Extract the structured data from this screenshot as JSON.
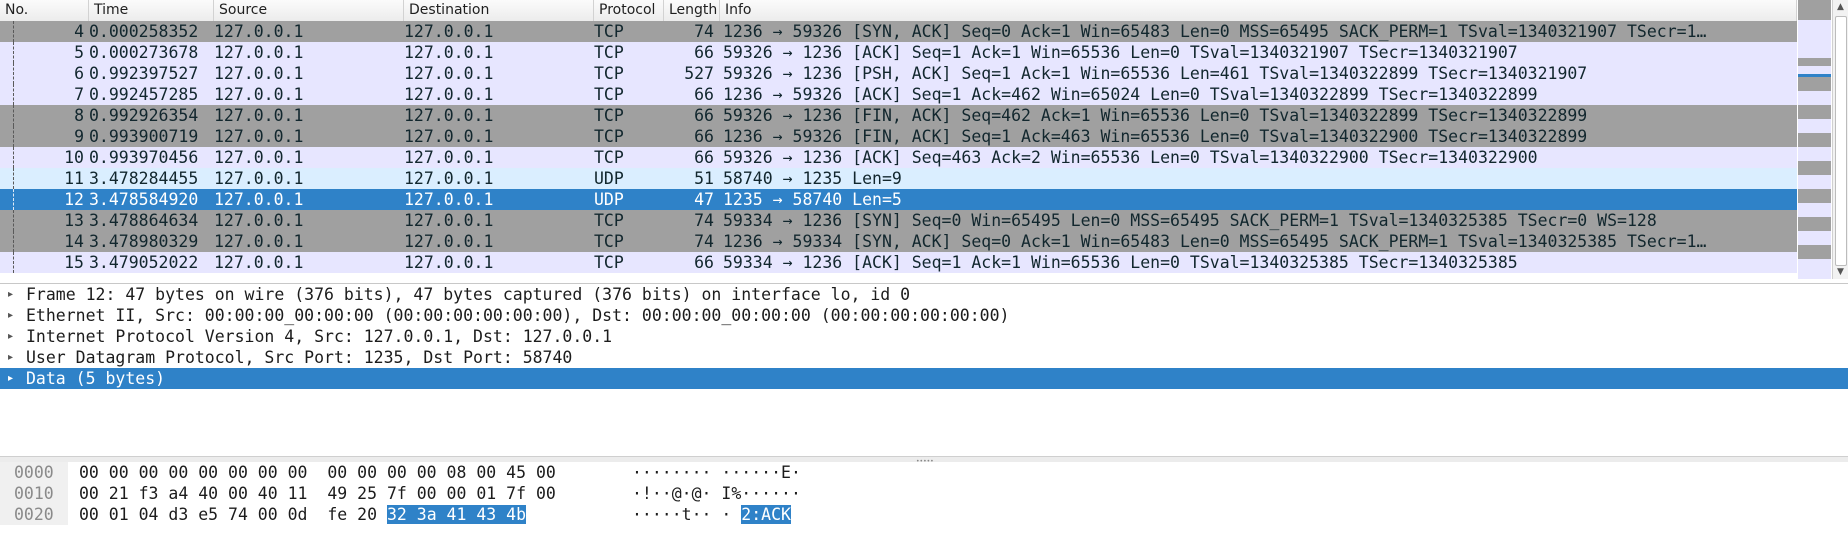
{
  "columns": [
    "No.",
    "Time",
    "Source",
    "Destination",
    "Protocol",
    "Length",
    "Info"
  ],
  "packets": [
    {
      "no": "4",
      "time": "0.000258352",
      "src": "127.0.0.1",
      "dst": "127.0.0.1",
      "proto": "TCP",
      "len": "74",
      "info": "1236 → 59326 [SYN, ACK] Seq=0 Ack=1 Win=65483 Len=0 MSS=65495 SACK_PERM=1 TSval=1340321907 TSecr=1…",
      "style": "tcp-flag"
    },
    {
      "no": "5",
      "time": "0.000273678",
      "src": "127.0.0.1",
      "dst": "127.0.0.1",
      "proto": "TCP",
      "len": "66",
      "info": "59326 → 1236 [ACK] Seq=1 Ack=1 Win=65536 Len=0 TSval=1340321907 TSecr=1340321907",
      "style": "tcp-normal"
    },
    {
      "no": "6",
      "time": "0.992397527",
      "src": "127.0.0.1",
      "dst": "127.0.0.1",
      "proto": "TCP",
      "len": "527",
      "info": "59326 → 1236 [PSH, ACK] Seq=1 Ack=1 Win=65536 Len=461 TSval=1340322899 TSecr=1340321907",
      "style": "tcp-normal"
    },
    {
      "no": "7",
      "time": "0.992457285",
      "src": "127.0.0.1",
      "dst": "127.0.0.1",
      "proto": "TCP",
      "len": "66",
      "info": "1236 → 59326 [ACK] Seq=1 Ack=462 Win=65024 Len=0 TSval=1340322899 TSecr=1340322899",
      "style": "tcp-normal"
    },
    {
      "no": "8",
      "time": "0.992926354",
      "src": "127.0.0.1",
      "dst": "127.0.0.1",
      "proto": "TCP",
      "len": "66",
      "info": "59326 → 1236 [FIN, ACK] Seq=462 Ack=1 Win=65536 Len=0 TSval=1340322899 TSecr=1340322899",
      "style": "tcp-flag"
    },
    {
      "no": "9",
      "time": "0.993900719",
      "src": "127.0.0.1",
      "dst": "127.0.0.1",
      "proto": "TCP",
      "len": "66",
      "info": "1236 → 59326 [FIN, ACK] Seq=1 Ack=463 Win=65536 Len=0 TSval=1340322900 TSecr=1340322899",
      "style": "tcp-flag"
    },
    {
      "no": "10",
      "time": "0.993970456",
      "src": "127.0.0.1",
      "dst": "127.0.0.1",
      "proto": "TCP",
      "len": "66",
      "info": "59326 → 1236 [ACK] Seq=463 Ack=2 Win=65536 Len=0 TSval=1340322900 TSecr=1340322900",
      "style": "tcp-normal"
    },
    {
      "no": "11",
      "time": "3.478284455",
      "src": "127.0.0.1",
      "dst": "127.0.0.1",
      "proto": "UDP",
      "len": "51",
      "info": "58740 → 1235 Len=9",
      "style": "udp"
    },
    {
      "no": "12",
      "time": "3.478584920",
      "src": "127.0.0.1",
      "dst": "127.0.0.1",
      "proto": "UDP",
      "len": "47",
      "info": "1235 → 58740 Len=5",
      "style": "selected"
    },
    {
      "no": "13",
      "time": "3.478864634",
      "src": "127.0.0.1",
      "dst": "127.0.0.1",
      "proto": "TCP",
      "len": "74",
      "info": "59334 → 1236 [SYN] Seq=0 Win=65495 Len=0 MSS=65495 SACK_PERM=1 TSval=1340325385 TSecr=0 WS=128",
      "style": "tcp-flag"
    },
    {
      "no": "14",
      "time": "3.478980329",
      "src": "127.0.0.1",
      "dst": "127.0.0.1",
      "proto": "TCP",
      "len": "74",
      "info": "1236 → 59334 [SYN, ACK] Seq=0 Ack=1 Win=65483 Len=0 MSS=65495 SACK_PERM=1 TSval=1340325385 TSecr=1…",
      "style": "tcp-flag"
    },
    {
      "no": "15",
      "time": "3.479052022",
      "src": "127.0.0.1",
      "dst": "127.0.0.1",
      "proto": "TCP",
      "len": "66",
      "info": "59334 → 1236 [ACK] Seq=1 Ack=1 Win=65536 Len=0 TSval=1340325385 TSecr=1340325385",
      "style": "tcp-normal"
    }
  ],
  "details": [
    {
      "text": "Frame 12: 47 bytes on wire (376 bits), 47 bytes captured (376 bits) on interface lo, id 0",
      "selected": false
    },
    {
      "text": "Ethernet II, Src: 00:00:00_00:00:00 (00:00:00:00:00:00), Dst: 00:00:00_00:00:00 (00:00:00:00:00:00)",
      "selected": false
    },
    {
      "text": "Internet Protocol Version 4, Src: 127.0.0.1, Dst: 127.0.0.1",
      "selected": false
    },
    {
      "text": "User Datagram Protocol, Src Port: 1235, Dst Port: 58740",
      "selected": false
    },
    {
      "text": "Data (5 bytes)",
      "selected": true
    }
  ],
  "bytes": [
    {
      "offset": "0000",
      "hex": "00 00 00 00 00 00 00 00  00 00 00 00 08 00 45 00",
      "hex_hl": "",
      "ascii": "········ ······E·",
      "ascii_hl": ""
    },
    {
      "offset": "0010",
      "hex": "00 21 f3 a4 40 00 40 11  49 25 7f 00 00 01 7f 00",
      "hex_hl": "",
      "ascii": "·!··@·@· I%······",
      "ascii_hl": ""
    },
    {
      "offset": "0020",
      "hex": "00 01 04 d3 e5 74 00 0d  fe 20 ",
      "hex_hl": "32 3a 41 43 4b",
      "ascii": "·····t·· · ",
      "ascii_hl": "2:ACK"
    }
  ],
  "colors": {
    "tcp_normal": "#e7e6ff",
    "tcp_flag": "#a0a0a0",
    "udp": "#daeeff",
    "selected": "#2f82c8"
  },
  "icons": {
    "expand": "triangle-right-icon",
    "scroll_up": "arrow-up-icon",
    "scroll_down": "arrow-down-icon"
  }
}
